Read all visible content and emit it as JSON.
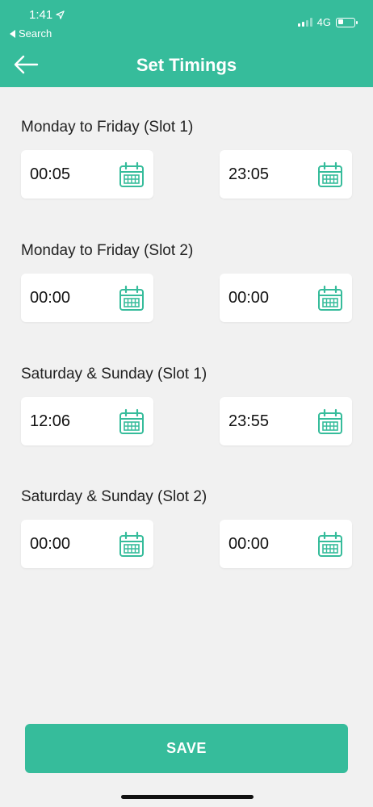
{
  "status_bar": {
    "time": "1:41",
    "back_label": "Search",
    "network": "4G"
  },
  "header": {
    "title": "Set Timings"
  },
  "slots": [
    {
      "label": "Monday to Friday (Slot 1)",
      "start": "00:05",
      "end": "23:05"
    },
    {
      "label": "Monday to Friday (Slot 2)",
      "start": "00:00",
      "end": "00:00"
    },
    {
      "label": "Saturday & Sunday (Slot 1)",
      "start": "12:06",
      "end": "23:55"
    },
    {
      "label": "Saturday & Sunday (Slot 2)",
      "start": "00:00",
      "end": "00:00"
    }
  ],
  "save_label": "SAVE",
  "colors": {
    "accent": "#36bc9b",
    "background": "#f1f1f1"
  }
}
